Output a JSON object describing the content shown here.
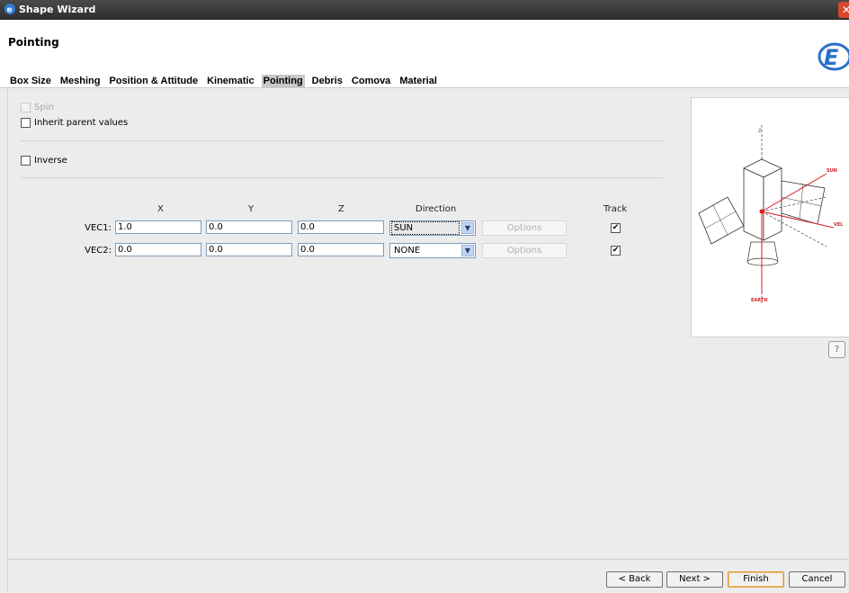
{
  "window": {
    "title": "Shape Wizard",
    "close_glyph": "✕"
  },
  "header": {
    "page_title": "Pointing",
    "logo": "e2-logo"
  },
  "tabs": [
    {
      "label": "Box Size",
      "active": false
    },
    {
      "label": "Meshing",
      "active": false
    },
    {
      "label": "Position & Attitude",
      "active": false
    },
    {
      "label": "Kinematic",
      "active": false
    },
    {
      "label": "Pointing",
      "active": true
    },
    {
      "label": "Debris",
      "active": false
    },
    {
      "label": "Comova",
      "active": false
    },
    {
      "label": "Material",
      "active": false
    }
  ],
  "options": {
    "spin": {
      "label": "Spin",
      "checked": false,
      "enabled": false
    },
    "inherit": {
      "label": "Inherit parent values",
      "checked": false
    },
    "inverse": {
      "label": "Inverse",
      "checked": false
    }
  },
  "table": {
    "headers": {
      "x": "X",
      "y": "Y",
      "z": "Z",
      "direction": "Direction",
      "track": "Track"
    },
    "rows": [
      {
        "label": "VEC1:",
        "x": "1.0",
        "y": "0.0",
        "z": "0.0",
        "direction": "SUN",
        "options_label": "Options",
        "track": true
      },
      {
        "label": "VEC2:",
        "x": "0.0",
        "y": "0.0",
        "z": "0.0",
        "direction": "NONE",
        "options_label": "Options",
        "track": true
      }
    ]
  },
  "diagram": {
    "labels": {
      "z": "Z",
      "sun": "SUN",
      "vel": "VEL",
      "earth": "EARTH"
    }
  },
  "help_glyph": "?",
  "buttons": {
    "back": "< Back",
    "next": "Next >",
    "finish": "Finish",
    "cancel": "Cancel"
  },
  "colors": {
    "accent_red": "#d42020",
    "titlebar": "#3a3a3a",
    "finish_border": "#d89b3a"
  }
}
